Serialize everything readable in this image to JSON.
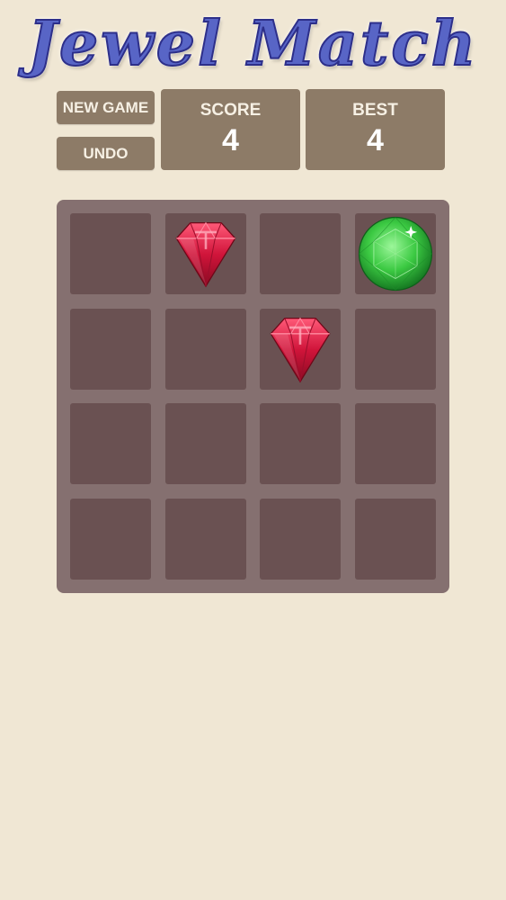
{
  "app": {
    "title": "Jewel Match"
  },
  "controls": {
    "new_game_label": "NEW GAME",
    "undo_label": "UNDO"
  },
  "score": {
    "label": "SCORE",
    "value": "4"
  },
  "best": {
    "label": "BEST",
    "value": "4"
  },
  "board": {
    "rows": 4,
    "cols": 4,
    "tiles": [
      {
        "row": 0,
        "col": 1,
        "gem": "ruby"
      },
      {
        "row": 0,
        "col": 3,
        "gem": "emerald"
      },
      {
        "row": 1,
        "col": 2,
        "gem": "ruby"
      }
    ]
  },
  "colors": {
    "background": "#f0e7d4",
    "button": "#8d7b67",
    "board": "#857070",
    "cell": "#6a5152",
    "title": "#5865c6",
    "ruby": "#c8163a",
    "emerald": "#2fbf3a"
  }
}
